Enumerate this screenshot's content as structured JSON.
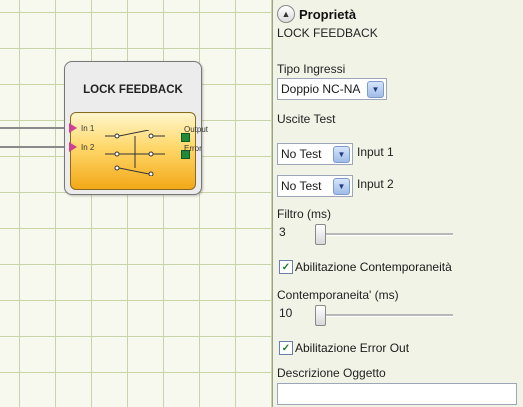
{
  "block": {
    "title": "LOCK FEEDBACK",
    "inputs": [
      "In 1",
      "In 2"
    ],
    "outputs": [
      "Output",
      "Error"
    ]
  },
  "panel": {
    "title": "Proprietà",
    "subtitle": "LOCK FEEDBACK",
    "input_type_label": "Tipo Ingressi",
    "input_type_value": "Doppio NC-NA",
    "test_outputs_label": "Uscite Test",
    "test1_value": "No Test",
    "test1_label": "Input 1",
    "test2_value": "No Test",
    "test2_label": "Input 2",
    "filter_label": "Filtro (ms)",
    "filter_value": "3",
    "simultaneity_enable_label": "Abilitazione Contemporaneità",
    "simultaneity_label": "Contemporaneita' (ms)",
    "simultaneity_value": "10",
    "error_out_enable_label": "Abilitazione Error Out",
    "description_label": "Descrizione Oggetto",
    "description_value": ""
  },
  "icons": {
    "collapse": "chevron-up-icon",
    "dropdown": "chevron-down-icon",
    "check": "check-icon"
  },
  "colors": {
    "block_fill": "#ffd86a",
    "pin_input": "#d04090",
    "pin_output": "#1e8a3a"
  }
}
